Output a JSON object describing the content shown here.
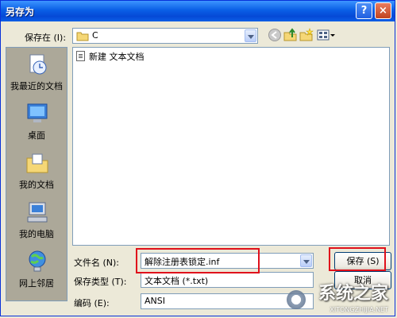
{
  "window": {
    "title": "另存为",
    "help_label": "?",
    "close_label": "×"
  },
  "toolbar": {
    "save_in_label": "保存在 (I):",
    "location": "C",
    "icons": [
      "back-icon",
      "up-folder-icon",
      "new-folder-icon",
      "views-icon"
    ]
  },
  "places": [
    {
      "label": "我最近的文档",
      "icon": "recent-documents-icon"
    },
    {
      "label": "桌面",
      "icon": "desktop-icon"
    },
    {
      "label": "我的文档",
      "icon": "my-documents-icon"
    },
    {
      "label": "我的电脑",
      "icon": "my-computer-icon"
    },
    {
      "label": "网上邻居",
      "icon": "network-places-icon"
    }
  ],
  "files": [
    {
      "name": "新建 文本文档",
      "icon": "text-file-icon"
    }
  ],
  "form": {
    "filename_label": "文件名 (N):",
    "filename_value": "解除注册表锁定.inf",
    "filetype_label": "保存类型 (T):",
    "filetype_value": "文本文档 (*.txt)",
    "encoding_label": "编码 (E):",
    "encoding_value": "ANSI"
  },
  "buttons": {
    "save_label": "保存 (S)",
    "cancel_label": "取消"
  },
  "watermark": {
    "text": "系统之家",
    "url": "XITONGZHIJIA.NET"
  },
  "colors": {
    "titlebar": "#0a5fe5",
    "dialog_bg": "#ece9d8",
    "places_bg": "#aca899",
    "highlight": "#e0101b"
  }
}
